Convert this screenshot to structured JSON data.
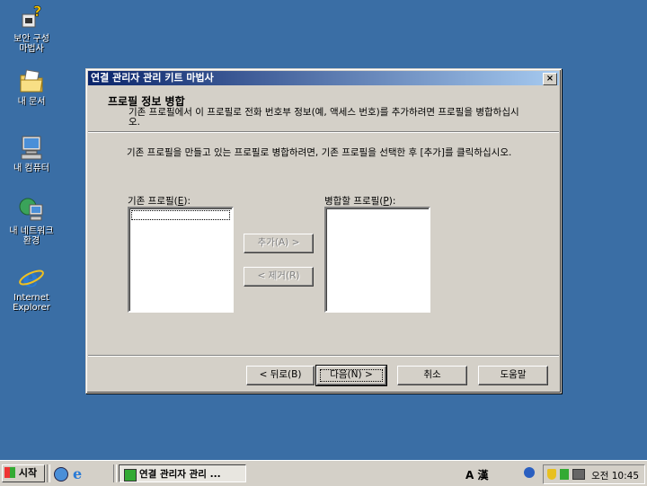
{
  "desktop": {
    "icons": [
      {
        "label": "보안 구성\n마법사",
        "icon": "security-wizard-icon"
      },
      {
        "label": "내 문서",
        "icon": "my-documents-icon"
      },
      {
        "label": "내 컴퓨터",
        "icon": "my-computer-icon"
      },
      {
        "label": "내 네트워크\n환경",
        "icon": "network-places-icon"
      },
      {
        "label": "Internet\nExplorer",
        "icon": "internet-explorer-icon"
      }
    ]
  },
  "dialog": {
    "title": "연결 관리자 관리 키트 마법사",
    "close": "×",
    "header_title": "프로필 정보 병합",
    "header_desc": "기존 프로필에서 이 프로필로 전화 번호부 정보(예, 액세스 번호)를 추가하려면 프로필을 병합하십시오.",
    "body_text": "기존 프로필을 만들고 있는 프로필로 병합하려면, 기존 프로필을 선택한 후 [추가]를 클릭하십시오.",
    "existing_label_pre": "기존 프로필(",
    "existing_label_key": "E",
    "existing_label_post": "):",
    "merge_label_pre": "병합할 프로필(",
    "merge_label_key": "P",
    "merge_label_post": "):",
    "add_button": "추가(A) >",
    "remove_button": "< 제거(R)",
    "back_button": "< 뒤로(B)",
    "next_button": "다음(N) >",
    "cancel_button": "취소",
    "help_button": "도움말"
  },
  "taskbar": {
    "start": "시작",
    "task_label": "연결 관리자 관리 ...",
    "tray_text": "A 漢",
    "clock": "오전 10:45"
  },
  "colors": {
    "desktop": "#3a6ea5",
    "titlebar_start": "#0a246a",
    "titlebar_end": "#a6caf0",
    "face": "#d4d0c8"
  }
}
